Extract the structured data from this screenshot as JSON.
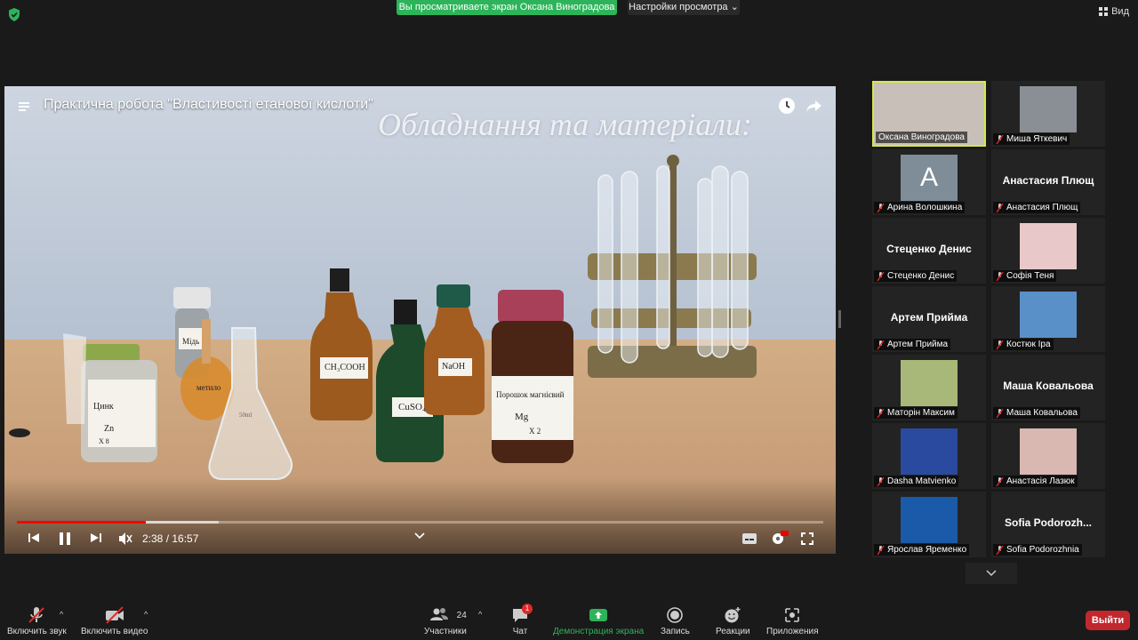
{
  "banner": "Вы просматриваете экран Оксана Виноградова",
  "view_settings": "Настройки просмотра ⌄",
  "view_button": "Вид",
  "video": {
    "title": "Практична робота \"Властивості етанової кислоти\"",
    "overlay": "Обладнання та матеріали:",
    "time": "2:38 / 16:57",
    "progress": 0.16,
    "buffered": 0.25,
    "labels": {
      "zinc": "Цинк",
      "zn": "Zn",
      "zinc_qty": "Х  8",
      "copper": "Мідь",
      "methyl": "метило",
      "acetic": "CH₃COOH",
      "cuso4": "CuSO₄",
      "naoh": "NaOH",
      "mg_name": "Порошок магнієвий",
      "mg": "Mg",
      "mg_qty": "Х   2",
      "flask": "50ml"
    }
  },
  "participants": [
    {
      "name": "Оксана Виноградова",
      "display": "",
      "active": true,
      "muted": false
    },
    {
      "name": "Миша Яткевич",
      "display": "",
      "muted": true
    },
    {
      "name": "Арина Волошкина",
      "display": "A",
      "muted": true
    },
    {
      "name": "Анастасия Плющ",
      "display": "Анастасия Плющ",
      "muted": true
    },
    {
      "name": "Стеценко Денис",
      "display": "Стеценко Денис",
      "muted": true
    },
    {
      "name": "Софія Теня",
      "display": "",
      "muted": true
    },
    {
      "name": "Артем Прийма",
      "display": "Артем Прийма",
      "muted": true
    },
    {
      "name": "Костюк Іра",
      "display": "",
      "muted": true
    },
    {
      "name": "Маторін Максим",
      "display": "",
      "muted": true
    },
    {
      "name": "Маша Ковальова",
      "display": "Маша Ковальова",
      "muted": true
    },
    {
      "name": "Dasha Matvienko",
      "display": "",
      "muted": true
    },
    {
      "name": "Анастасія Лазюк",
      "display": "",
      "muted": true
    },
    {
      "name": "Ярослав Яременко",
      "display": "",
      "muted": true
    },
    {
      "name": "Sofia Podorozhnia",
      "display": "Sofia  Podorozh...",
      "muted": true
    }
  ],
  "toolbar": {
    "unmute": "Включить звук",
    "start_video": "Включить видео",
    "participants": "Участники",
    "participants_count": "24",
    "chat": "Чат",
    "chat_badge": "1",
    "share": "Демонстрация экрана",
    "record": "Запись",
    "reactions": "Реакции",
    "apps": "Приложения",
    "leave": "Выйти"
  }
}
